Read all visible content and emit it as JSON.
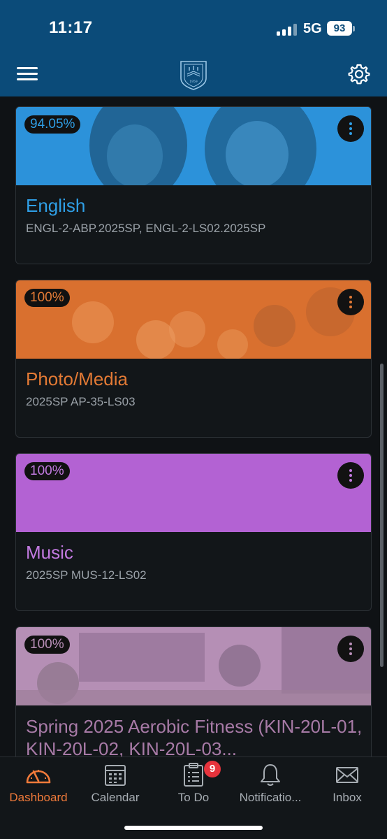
{
  "status_bar": {
    "time": "11:17",
    "network": "5G",
    "battery": "93"
  },
  "header": {
    "logo_year": "1959"
  },
  "courses": [
    {
      "grade": "94.05%",
      "title": "English",
      "code": "ENGL-2-ABP.2025SP, ENGL-2-LS02.2025SP",
      "color": "#2f9fe6"
    },
    {
      "grade": "100%",
      "title": "Photo/Media",
      "code": "2025SP AP-35-LS03",
      "color": "#e37a35"
    },
    {
      "grade": "100%",
      "title": "Music",
      "code": "2025SP MUS-12-LS02",
      "color": "#b362d3"
    },
    {
      "grade": "100%",
      "title": "Spring 2025 Aerobic Fitness (KIN-20L-01, KIN-20L-02, KIN-20L-03...",
      "code": "",
      "color": "#a77aa6"
    }
  ],
  "tabs": [
    {
      "label": "Dashboard",
      "icon": "dashboard-gauge-icon",
      "active": true
    },
    {
      "label": "Calendar",
      "icon": "calendar-icon"
    },
    {
      "label": "To Do",
      "icon": "clipboard-icon",
      "badge": "9"
    },
    {
      "label": "Notificatio...",
      "icon": "bell-icon"
    },
    {
      "label": "Inbox",
      "icon": "envelope-icon"
    }
  ],
  "colors": {
    "header": "#0b4b79",
    "accent": "#f07a3a",
    "background": "#0f1215"
  }
}
